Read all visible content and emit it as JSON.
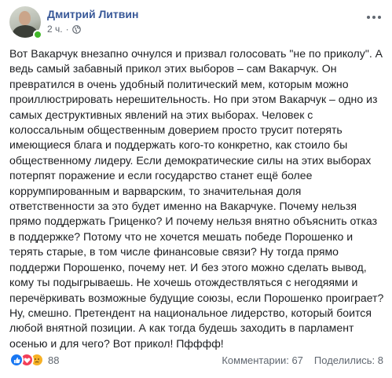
{
  "post": {
    "author": "Дмитрий Литвин",
    "time": "2 ч.",
    "separator": "·",
    "text": "Вот Вакарчук внезапно очнулся и призвал голосовать \"не по приколу\". А ведь самый забавный прикол этих выборов – сам Вакарчук. Он превратился в очень удобный политический мем, которым можно проиллюстрировать нерешительность. Но при этом Вакарчук – одно из самых деструктивных явлений на этих выборах. Человек с колоссальным общественным доверием просто трусит потерять имеющиеся блага и поддержать кого-то конкретно, как стоило бы общественному лидеру. Если демократические силы на этих выборах потерпят поражение и если государство станет ещё более коррумпированным и варварским, то значительная доля ответственности за это будет именно на Вакарчуке. Почему нельзя прямо поддержать Гриценко? И почему нельзя внятно объяснить отказ в поддержке? Потому что не хочется мешать победе Порошенко и терять старые, в том числе финансовые связи? Ну тогда прямо поддержи Порошенко, почему нет. И без этого можно сделать вывод, кому ты подыгрываешь. Не хочешь отождествляться с негодяями и перечёркивать возможные будущие союзы, если Порошенко проиграет? Ну, смешно. Претендент на национальное лидерство, который боится любой внятной позиции. А как тогда будешь заходить в парламент осенью и для чего? Вот прикол! Пфффф!"
  },
  "footer": {
    "reactions": [
      "like-icon",
      "love-icon",
      "sad-icon"
    ],
    "reaction_count": "88",
    "comments": "Комментарии: 67",
    "shares": "Поделились: 8"
  },
  "colors": {
    "author": "#385898",
    "meta": "#606770",
    "like": "#1877f2",
    "love": "#f33e58",
    "sad": "#f7b125",
    "online": "#42b72a"
  }
}
